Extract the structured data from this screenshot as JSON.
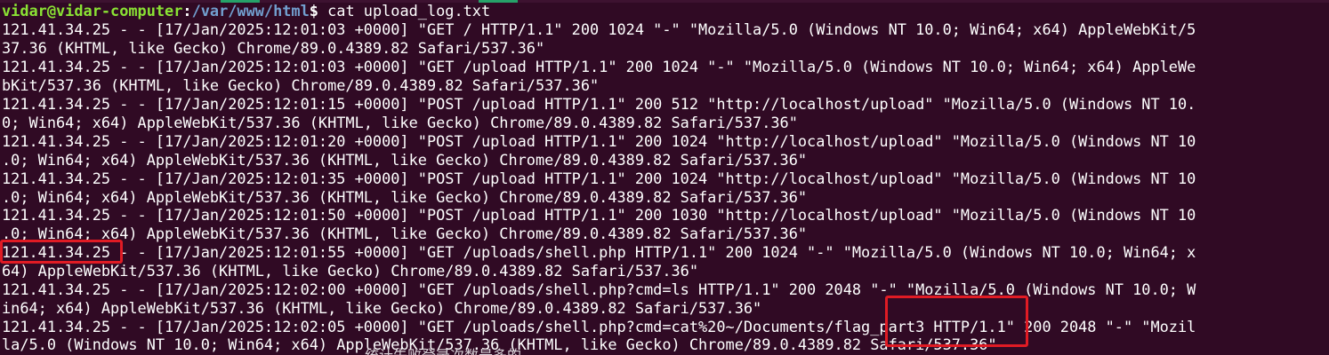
{
  "prompt": {
    "user_host": "vidar@vidar-computer",
    "separator": ":",
    "path": "/var/www/html",
    "symbol": "$",
    "command": " cat upload_log.txt"
  },
  "output_lines": [
    "121.41.34.25 - - [17/Jan/2025:12:01:03 +0000] \"GET / HTTP/1.1\" 200 1024 \"-\" \"Mozilla/5.0 (Windows NT 10.0; Win64; x64) AppleWebKit/5",
    "37.36 (KHTML, like Gecko) Chrome/89.0.4389.82 Safari/537.36\"",
    "121.41.34.25 - - [17/Jan/2025:12:01:03 +0000] \"GET /upload HTTP/1.1\" 200 1024 \"-\" \"Mozilla/5.0 (Windows NT 10.0; Win64; x64) AppleWe",
    "bKit/537.36 (KHTML, like Gecko) Chrome/89.0.4389.82 Safari/537.36\"",
    "121.41.34.25 - - [17/Jan/2025:12:01:15 +0000] \"POST /upload HTTP/1.1\" 200 512 \"http://localhost/upload\" \"Mozilla/5.0 (Windows NT 10.",
    "0; Win64; x64) AppleWebKit/537.36 (KHTML, like Gecko) Chrome/89.0.4389.82 Safari/537.36\"",
    "121.41.34.25 - - [17/Jan/2025:12:01:20 +0000] \"POST /upload HTTP/1.1\" 200 1024 \"http://localhost/upload\" \"Mozilla/5.0 (Windows NT 10",
    ".0; Win64; x64) AppleWebKit/537.36 (KHTML, like Gecko) Chrome/89.0.4389.82 Safari/537.36\"",
    "121.41.34.25 - - [17/Jan/2025:12:01:35 +0000] \"POST /upload HTTP/1.1\" 200 1024 \"http://localhost/upload\" \"Mozilla/5.0 (Windows NT 10",
    ".0; Win64; x64) AppleWebKit/537.36 (KHTML, like Gecko) Chrome/89.0.4389.82 Safari/537.36\"",
    "121.41.34.25 - - [17/Jan/2025:12:01:50 +0000] \"POST /upload HTTP/1.1\" 200 1030 \"http://localhost/upload\" \"Mozilla/5.0 (Windows NT 10",
    ".0; Win64; x64) AppleWebKit/537.36 (KHTML, like Gecko) Chrome/89.0.4389.82 Safari/537.36\"",
    "121.41.34.25 - - [17/Jan/2025:12:01:55 +0000] \"GET /uploads/shell.php HTTP/1.1\" 200 1024 \"-\" \"Mozilla/5.0 (Windows NT 10.0; Win64; x",
    "64) AppleWebKit/537.36 (KHTML, like Gecko) Chrome/89.0.4389.82 Safari/537.36\"",
    "121.41.34.25 - - [17/Jan/2025:12:02:00 +0000] \"GET /uploads/shell.php?cmd=ls HTTP/1.1\" 200 2048 \"-\" \"Mozilla/5.0 (Windows NT 10.0; W",
    "in64; x64) AppleWebKit/537.36 (KHTML, like Gecko) Chrome/89.0.4389.82 Safari/537.36\"",
    "121.41.34.25 - - [17/Jan/2025:12:02:05 +0000] \"GET /uploads/shell.php?cmd=cat%20~/Documents/flag_part3 HTTP/1.1\" 200 2048 \"-\" \"Mozil",
    "la/5.0 (Windows NT 10.0; Win64; x64) AppleWebKit/537.36 (KHTML, like Gecko) Chrome/89.0.4389.82 Safari/537.36\""
  ],
  "cutoff_caption": "统计失败登录次数最多的",
  "colors": {
    "background": "#300a24",
    "text": "#ffffff",
    "prompt_user": "#8ae234",
    "prompt_path": "#729fcf",
    "highlight_box": "#e01b24"
  }
}
